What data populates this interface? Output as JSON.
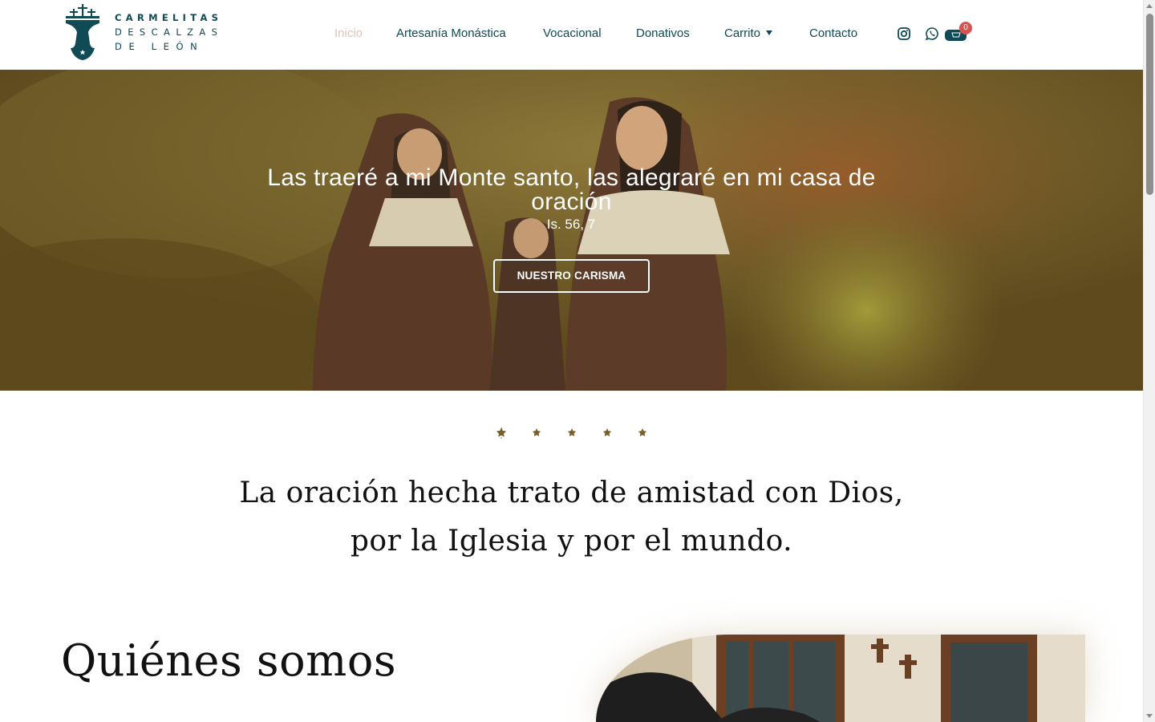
{
  "brand": {
    "line1": "CARMELITAS",
    "line2": "DESCALZAS",
    "line3": "DE LEÓN",
    "logo_icon": "carmel-shield-icon"
  },
  "nav": {
    "items": [
      {
        "label": "Inicio",
        "active": true
      },
      {
        "label": "Artesanía Monástica",
        "active": false
      },
      {
        "label": "Vocacional",
        "active": false
      },
      {
        "label": "Donativos",
        "active": false
      },
      {
        "label": "Carrito",
        "active": false,
        "has_dropdown": true
      },
      {
        "label": "Contacto",
        "active": false
      }
    ],
    "social": [
      "instagram-icon",
      "whatsapp-icon"
    ],
    "cart": {
      "icon": "cart-icon",
      "count": "0"
    }
  },
  "hero": {
    "title": "Las traeré a mi Monte santo, las alegraré en mi casa de oración",
    "reference": "Is. 56, 7",
    "button_label": "NUESTRO CARISMA"
  },
  "divider": {
    "icon": "star-icon",
    "count": 5,
    "color": "#7a5d27"
  },
  "quote": {
    "line1": "La oración hecha trato de amistad con Dios,",
    "line2": "por la Iglesia y por el mundo."
  },
  "about": {
    "title": "Quiénes somos"
  },
  "colors": {
    "primary": "#0f4a55",
    "active_nav": "#e2c2b7",
    "overlay": "#6d5822",
    "badge": "#d9534f"
  }
}
